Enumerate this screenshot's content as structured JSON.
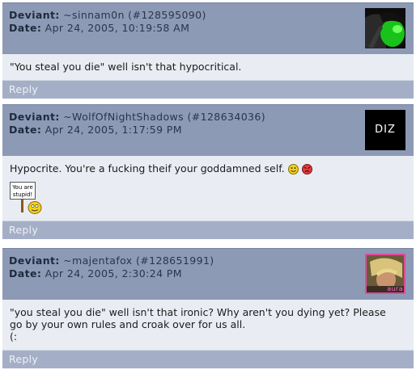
{
  "comments": [
    {
      "label_deviant": "Deviant:",
      "username": "~sinnam0n",
      "id": "(#128595090)",
      "label_date": "Date:",
      "date": "Apr 24, 2005, 10:19:58 AM",
      "text": "\"You steal you die\" well isn't that hypocritical.",
      "reply": "Reply"
    },
    {
      "label_deviant": "Deviant:",
      "username": "~WolfOfNightShadows",
      "id": "(#128634036)",
      "label_date": "Date:",
      "date": "Apr 24, 2005, 1:17:59 PM",
      "text": "Hypocrite. You're a fucking theif your goddamned self.",
      "avatar_text": "DIZ",
      "sign_text_1": "You are",
      "sign_text_2": "stupid!",
      "reply": "Reply"
    },
    {
      "label_deviant": "Deviant:",
      "username": "~majentafox",
      "id": "(#128651991)",
      "label_date": "Date:",
      "date": "Apr 24, 2005, 2:30:24 PM",
      "text_line1": "\"you steal you die\" well isn't that ironic? Why aren't you dying yet? Please",
      "text_line2": "go by your own rules and croak over for us all.",
      "text_line3": "(:",
      "avatar_text": "aura",
      "reply": "Reply"
    }
  ]
}
